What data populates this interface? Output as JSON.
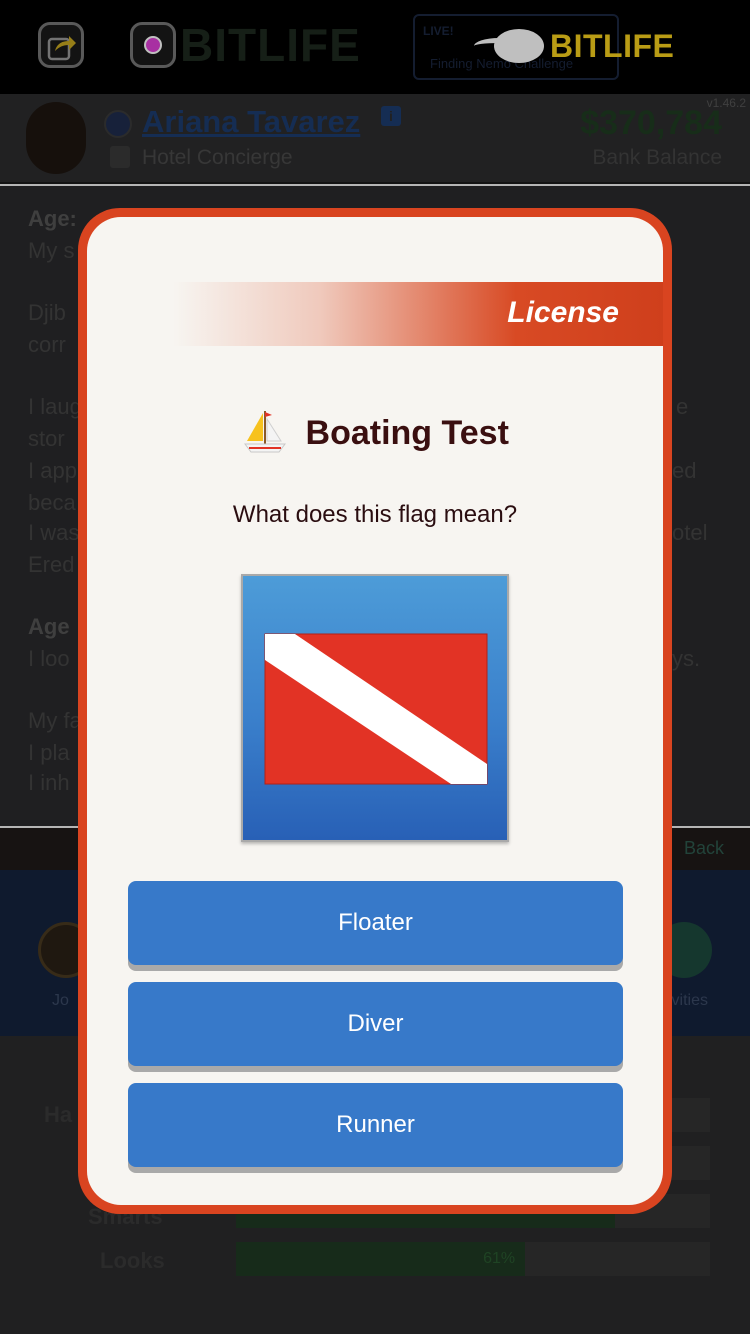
{
  "topbar": {
    "background_logo": "BITLIFE",
    "news_label": "LIVE!",
    "news_ticker": "Finding Nemo Challenge",
    "brand_name": "BITLIFE",
    "icons": [
      "share-icon",
      "instagram-icon",
      "sperm-logo-icon"
    ]
  },
  "profile": {
    "name": "Ariana Tavarez",
    "info_badge": "i",
    "job": "Hotel Concierge",
    "version": "v1.46.2",
    "balance": "$370,784",
    "balance_label": "Bank Balance"
  },
  "story": {
    "visible_fragments": [
      {
        "text": "Age: ",
        "bold": true
      },
      {
        "text": "My s"
      },
      {
        "text": "Djib"
      },
      {
        "text": "corr"
      },
      {
        "text": "I laug"
      },
      {
        "text": "stor"
      },
      {
        "text": "I app"
      },
      {
        "text": "beca"
      },
      {
        "text": "I was"
      },
      {
        "text": "Ered"
      },
      {
        "text": "Age",
        "bold": true
      },
      {
        "text": "I loo"
      },
      {
        "text": "My fa"
      },
      {
        "text": "I pla"
      },
      {
        "text": "I inh"
      }
    ],
    "right_fragments": [
      "e",
      "ed",
      "otel",
      "ys."
    ]
  },
  "bottom": {
    "back_label": "Back",
    "nav_left_label": "Jo",
    "nav_right_label": "ivities"
  },
  "stats": {
    "bars": [
      {
        "label": "Ha",
        "percent": null
      },
      {
        "label": "Smarts",
        "percent": 80
      },
      {
        "label": "Looks",
        "percent": 61,
        "percent_text": "61%"
      }
    ]
  },
  "modal": {
    "category": "License",
    "title": "Boating Test",
    "title_icon": "sailboat-icon",
    "question": "What does this flag mean?",
    "flag_icon": "diver-down-flag",
    "colors": {
      "frame": "#d94420",
      "button": "#3779c9",
      "flag_red": "#e23325",
      "flag_bg_top": "#4d9cd8",
      "flag_bg_bottom": "#2860b6"
    },
    "answers": [
      "Floater",
      "Diver",
      "Runner"
    ]
  }
}
